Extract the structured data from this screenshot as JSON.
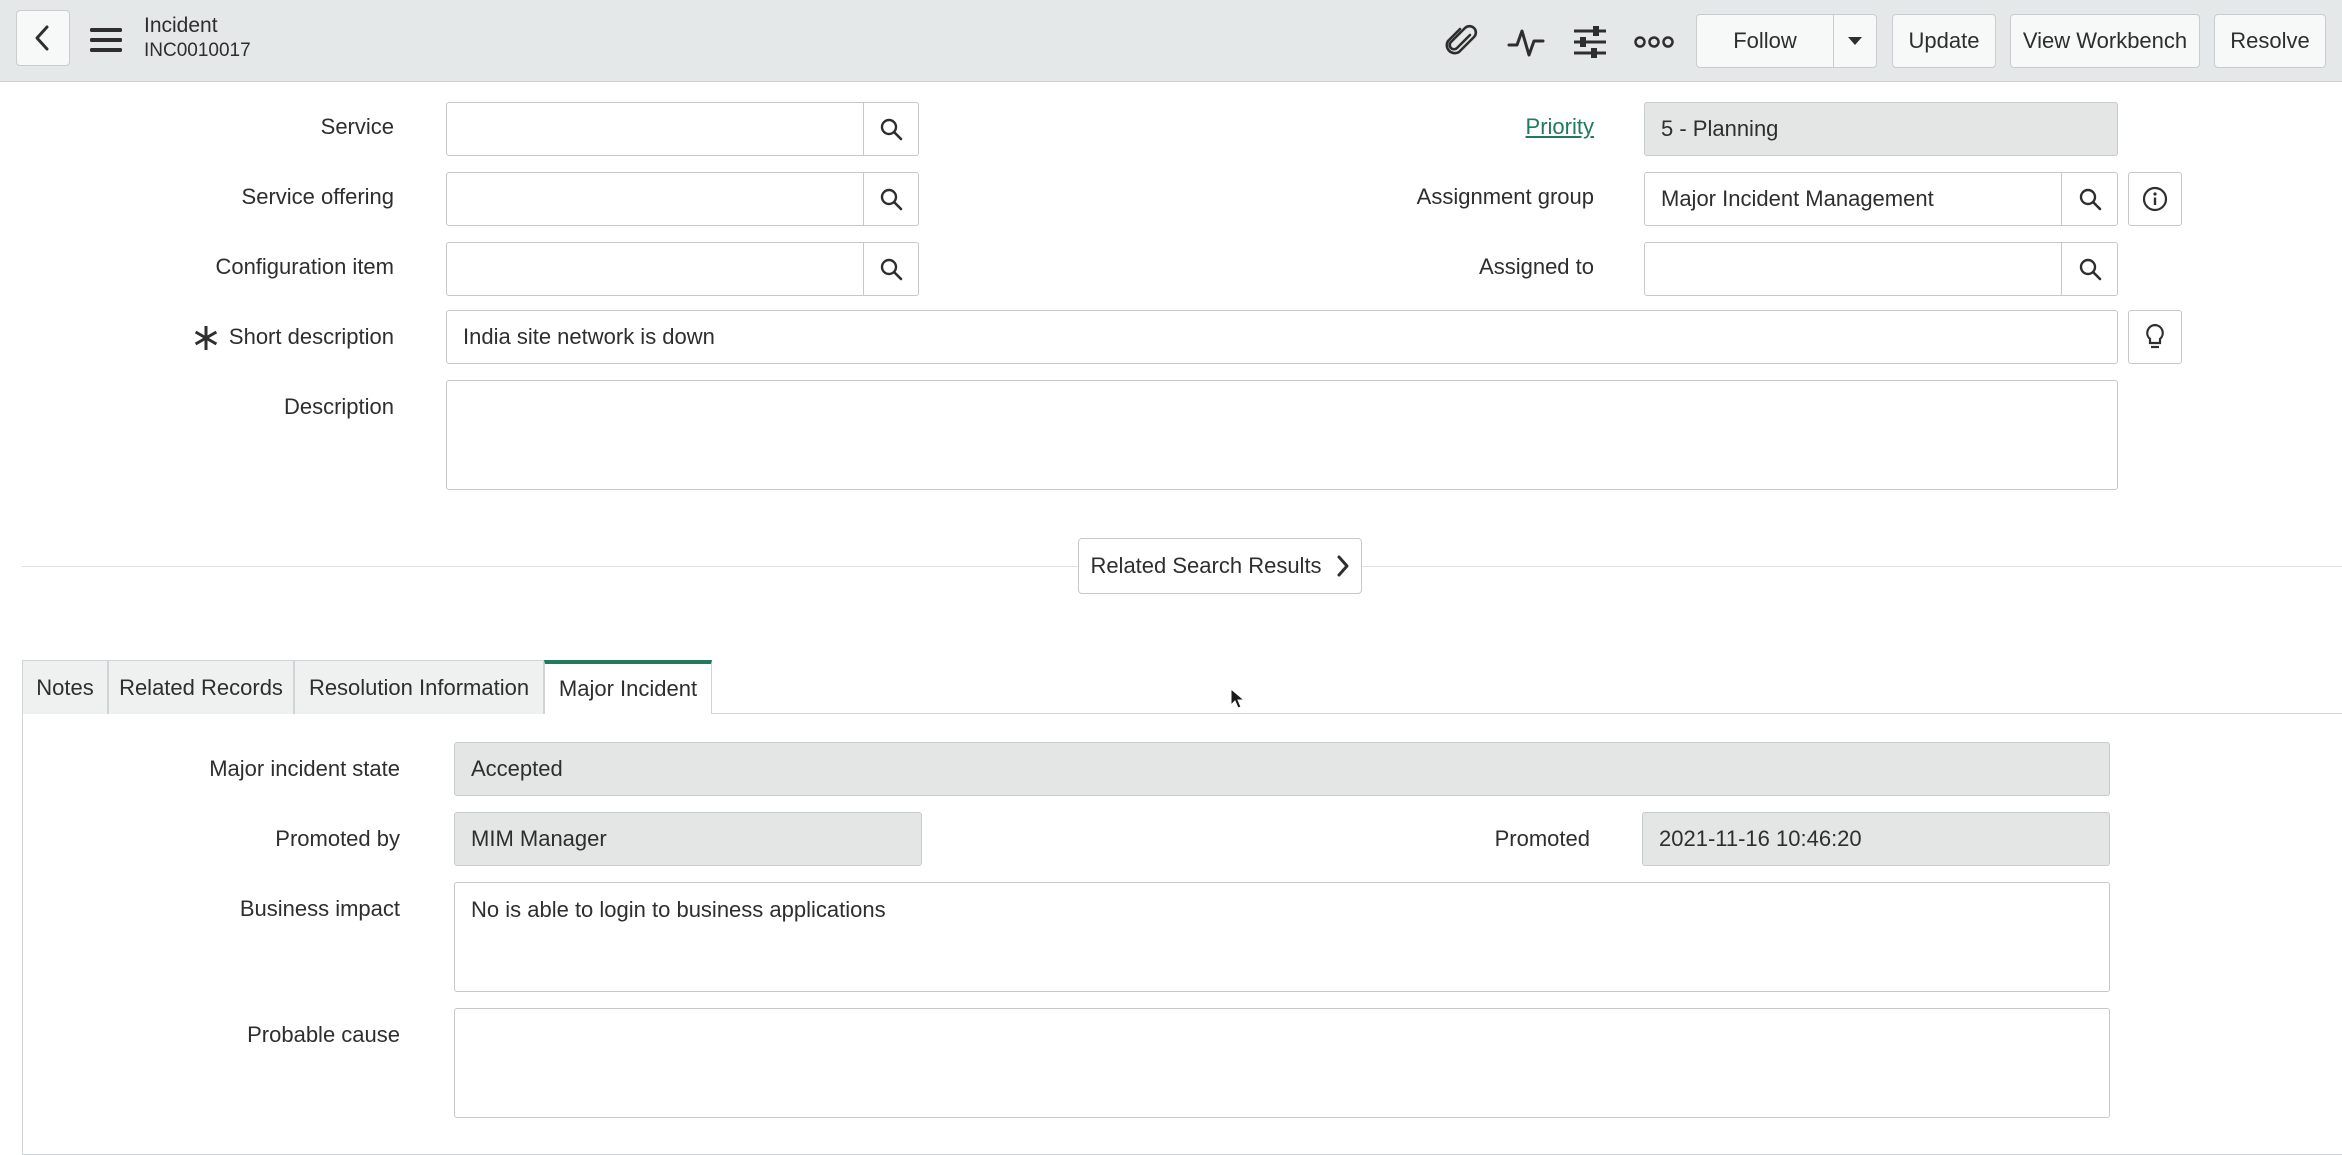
{
  "header": {
    "record_type": "Incident",
    "record_number": "INC0010017",
    "follow_label": "Follow",
    "update_label": "Update",
    "workbench_label": "View Workbench",
    "resolve_label": "Resolve"
  },
  "form": {
    "service_label": "Service",
    "service_value": "",
    "service_offering_label": "Service offering",
    "service_offering_value": "",
    "config_item_label": "Configuration item",
    "config_item_value": "",
    "short_description_label": "Short description",
    "short_description_value": "India site network is down",
    "description_label": "Description",
    "description_value": "",
    "priority_label": "Priority",
    "priority_value": "5 - Planning",
    "assignment_group_label": "Assignment group",
    "assignment_group_value": "Major Incident Management",
    "assigned_to_label": "Assigned to",
    "assigned_to_value": ""
  },
  "related_search_label": "Related Search Results",
  "tabs": [
    {
      "label": "Notes"
    },
    {
      "label": "Related Records"
    },
    {
      "label": "Resolution Information"
    },
    {
      "label": "Major Incident"
    }
  ],
  "major_incident": {
    "state_label": "Major incident state",
    "state_value": "Accepted",
    "promoted_by_label": "Promoted by",
    "promoted_by_value": "MIM Manager",
    "promoted_label": "Promoted",
    "promoted_value": "2021-11-16 10:46:20",
    "business_impact_label": "Business impact",
    "business_impact_value": "No is able to login to business applications",
    "probable_cause_label": "Probable cause",
    "probable_cause_value": ""
  },
  "colors": {
    "accent": "#1f7a5e",
    "header_bg": "#e5e8e8",
    "readonly_bg": "#e4e6e6"
  }
}
